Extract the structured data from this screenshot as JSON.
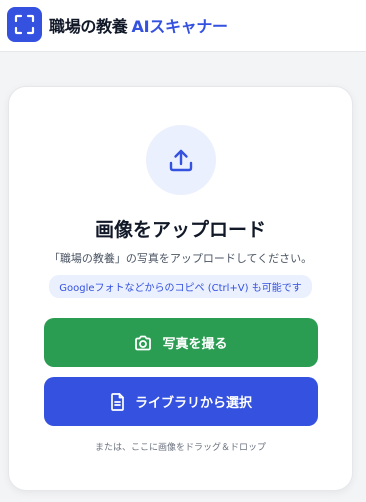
{
  "header": {
    "title": "職場の教養",
    "title_accent": "AIスキャナー",
    "logo_icon": "scan-frame-icon"
  },
  "card": {
    "upload_icon": "upload-icon",
    "title": "画像をアップロード",
    "description": "「職場の教養」の写真をアップロードしてください。",
    "hint": "Googleフォトなどからのコピペ (Ctrl+V) も可能です",
    "camera_button": {
      "label": "写真を撮る",
      "icon": "camera-icon",
      "color": "#2a9d52"
    },
    "library_button": {
      "label": "ライブラリから選択",
      "icon": "document-icon",
      "color": "#3451e0"
    },
    "drop_hint": "または、ここに画像をドラッグ＆ドロップ"
  },
  "colors": {
    "brand": "#3451e0",
    "background": "#f3f4f6"
  }
}
